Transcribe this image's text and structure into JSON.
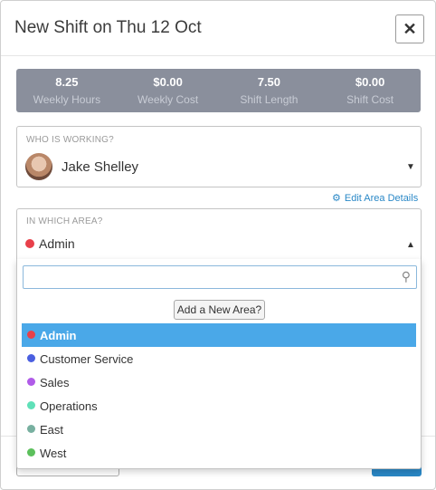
{
  "modal": {
    "title": "New Shift on Thu 12 Oct",
    "close_label": "✕"
  },
  "stats": [
    {
      "value": "8.25",
      "label": "Weekly Hours"
    },
    {
      "value": "$0.00",
      "label": "Weekly Cost"
    },
    {
      "value": "7.50",
      "label": "Shift Length"
    },
    {
      "value": "$0.00",
      "label": "Shift Cost"
    }
  ],
  "who": {
    "label": "WHO IS WORKING?",
    "name": "Jake Shelley",
    "caret": "▼"
  },
  "edit_area": {
    "icon": "gear-icon",
    "label": "Edit Area Details"
  },
  "area": {
    "label": "IN WHICH AREA?",
    "value": "Admin",
    "dot_color": "#e8404a",
    "caret": "▲"
  },
  "dropdown": {
    "search_placeholder": "",
    "add_area_label": "Add a New Area?",
    "options": [
      {
        "label": "Admin",
        "color": "#e8404a",
        "selected": true
      },
      {
        "label": "Customer Service",
        "color": "#4a5fe0",
        "selected": false
      },
      {
        "label": "Sales",
        "color": "#b05be8",
        "selected": false
      },
      {
        "label": "Operations",
        "color": "#5fe0b8",
        "selected": false
      },
      {
        "label": "East",
        "color": "#78b0a0",
        "selected": false
      },
      {
        "label": "West",
        "color": "#5cc05c",
        "selected": false
      }
    ]
  },
  "colors": {
    "accent": "#2a88c7",
    "selected_bg": "#4aa8e8",
    "stats_bg": "#8a8f9c"
  }
}
